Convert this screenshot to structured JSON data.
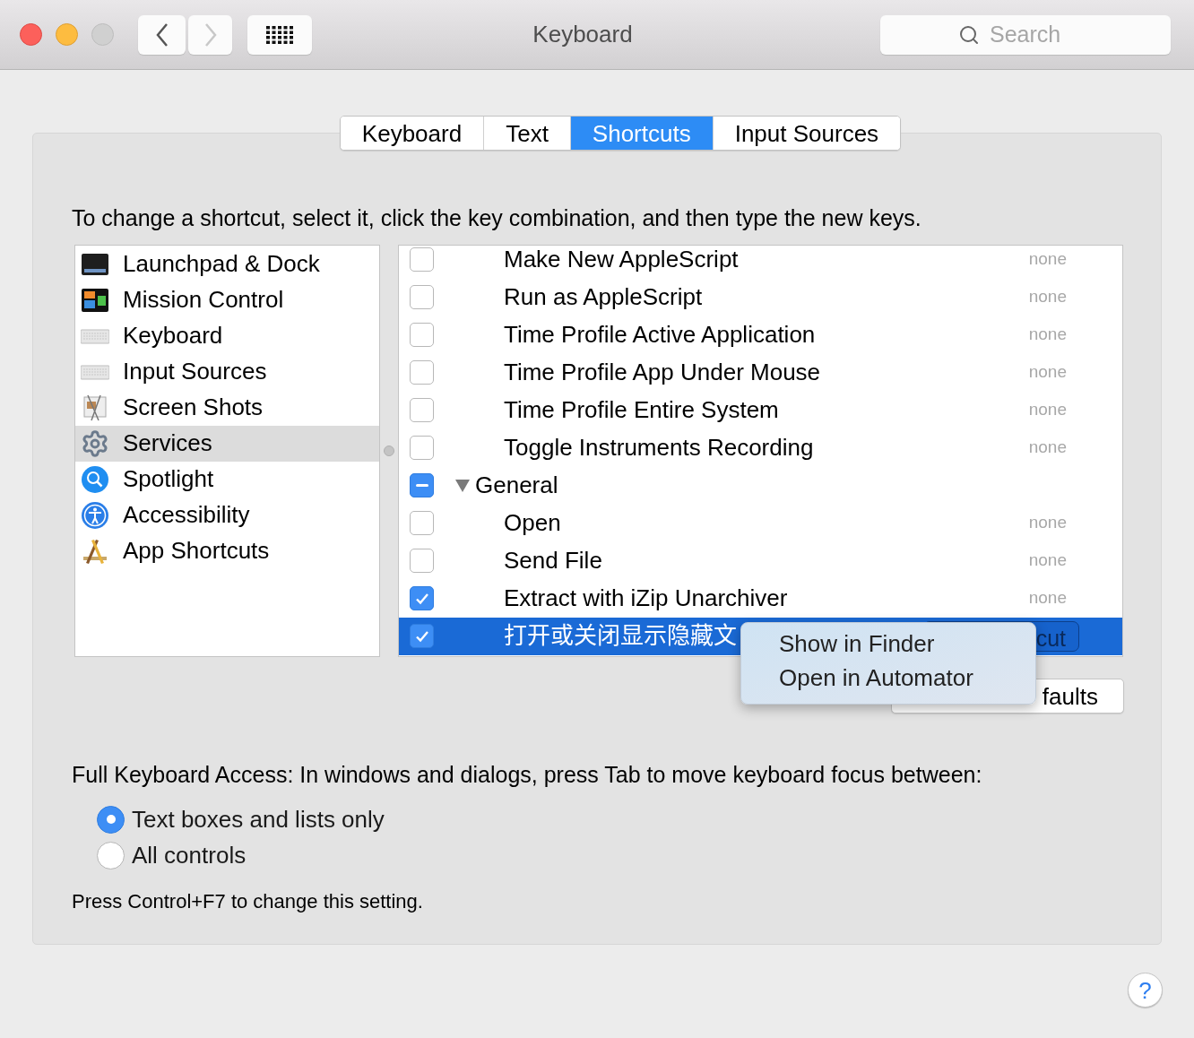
{
  "window": {
    "title": "Keyboard"
  },
  "toolbar": {
    "search": {
      "placeholder": "Search"
    }
  },
  "tabs": [
    {
      "label": "Keyboard",
      "selected": false
    },
    {
      "label": "Text",
      "selected": false
    },
    {
      "label": "Shortcuts",
      "selected": true
    },
    {
      "label": "Input Sources",
      "selected": false
    }
  ],
  "instruction": "To change a shortcut, select it, click the key combination, and then type the new keys.",
  "categories": [
    {
      "label": "Launchpad & Dock",
      "selected": false
    },
    {
      "label": "Mission Control",
      "selected": false
    },
    {
      "label": "Keyboard",
      "selected": false
    },
    {
      "label": "Input Sources",
      "selected": false
    },
    {
      "label": "Screen Shots",
      "selected": false
    },
    {
      "label": "Services",
      "selected": true
    },
    {
      "label": "Spotlight",
      "selected": false
    },
    {
      "label": "Accessibility",
      "selected": false
    },
    {
      "label": "App Shortcuts",
      "selected": false
    }
  ],
  "shortcuts": [
    {
      "kind": "item",
      "label": "Make New AppleScript",
      "checked": false,
      "selected": false,
      "shortcut": "none"
    },
    {
      "kind": "item",
      "label": "Run as AppleScript",
      "checked": false,
      "selected": false,
      "shortcut": "none"
    },
    {
      "kind": "item",
      "label": "Time Profile Active Application",
      "checked": false,
      "selected": false,
      "shortcut": "none"
    },
    {
      "kind": "item",
      "label": "Time Profile App Under Mouse",
      "checked": false,
      "selected": false,
      "shortcut": "none"
    },
    {
      "kind": "item",
      "label": "Time Profile Entire System",
      "checked": false,
      "selected": false,
      "shortcut": "none"
    },
    {
      "kind": "item",
      "label": "Toggle Instruments Recording",
      "checked": false,
      "selected": false,
      "shortcut": "none"
    },
    {
      "kind": "group",
      "label": "General",
      "checked": true,
      "mixed": true,
      "expanded": true,
      "selected": false
    },
    {
      "kind": "item",
      "label": "Open",
      "checked": false,
      "selected": false,
      "shortcut": "none"
    },
    {
      "kind": "item",
      "label": "Send File",
      "checked": false,
      "selected": false,
      "shortcut": "none"
    },
    {
      "kind": "item",
      "label": "Extract with iZip Unarchiver",
      "checked": true,
      "selected": false,
      "shortcut": "none"
    },
    {
      "kind": "item",
      "label": "打开或关闭显示隐藏文",
      "checked": true,
      "selected": true,
      "shortcut_button": "cut"
    }
  ],
  "context_menu": {
    "items": [
      {
        "label": "Show in Finder"
      },
      {
        "label": "Open in Automator"
      }
    ]
  },
  "restore_button": "faults",
  "full_keyboard_access": {
    "label": "Full Keyboard Access: In windows and dialogs, press Tab to move keyboard focus between:",
    "options": [
      {
        "label": "Text boxes and lists only",
        "selected": true
      },
      {
        "label": "All controls",
        "selected": false
      }
    ],
    "note": "Press Control+F7 to change this setting."
  },
  "help_button": "?"
}
